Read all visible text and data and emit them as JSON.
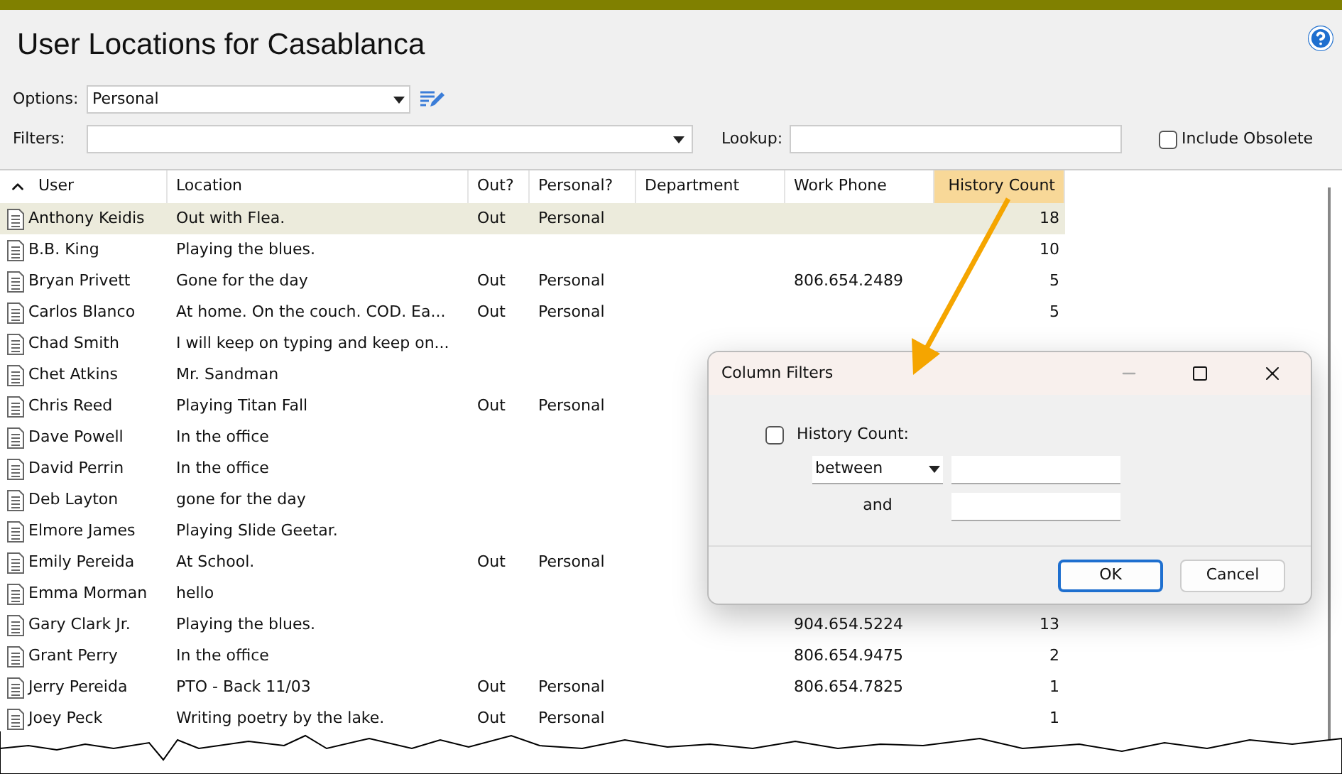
{
  "window": {
    "title": "User Locations for Casablanca"
  },
  "options": {
    "label": "Options:",
    "value": "Personal"
  },
  "filters": {
    "label": "Filters:"
  },
  "lookup": {
    "label": "Lookup:"
  },
  "include_obsolete": {
    "label": "Include Obsolete",
    "checked": false
  },
  "table": {
    "columns": [
      {
        "label": "User",
        "sorted": true,
        "highlighted": false
      },
      {
        "label": "Location",
        "sorted": false,
        "highlighted": false
      },
      {
        "label": "Out?",
        "sorted": false,
        "highlighted": false
      },
      {
        "label": "Personal?",
        "sorted": false,
        "highlighted": false
      },
      {
        "label": "Department",
        "sorted": false,
        "highlighted": false
      },
      {
        "label": "Work Phone",
        "sorted": false,
        "highlighted": false
      },
      {
        "label": "History Count",
        "sorted": false,
        "highlighted": true
      }
    ],
    "rows": [
      {
        "user": "Anthony Keidis",
        "location": "Out with Flea.",
        "out": "Out",
        "personal": "Personal",
        "phone": "",
        "count": "18",
        "selected": true
      },
      {
        "user": "B.B. King",
        "location": "Playing the blues.",
        "out": "",
        "personal": "",
        "phone": "",
        "count": "10",
        "selected": false
      },
      {
        "user": "Bryan Privett",
        "location": "Gone for the day",
        "out": "Out",
        "personal": "Personal",
        "phone": "806.654.2489",
        "count": "5",
        "selected": false
      },
      {
        "user": "Carlos Blanco",
        "location": "At home. On the couch. COD. Ea...",
        "out": "Out",
        "personal": "Personal",
        "phone": "",
        "count": "5",
        "selected": false
      },
      {
        "user": "Chad Smith",
        "location": "I will keep on typing and keep on...",
        "out": "",
        "personal": "",
        "phone": "",
        "count": "",
        "selected": false
      },
      {
        "user": "Chet Atkins",
        "location": "Mr. Sandman",
        "out": "",
        "personal": "",
        "phone": "",
        "count": "",
        "selected": false
      },
      {
        "user": "Chris Reed",
        "location": "Playing Titan Fall",
        "out": "Out",
        "personal": "Personal",
        "phone": "",
        "count": "",
        "selected": false
      },
      {
        "user": "Dave Powell",
        "location": "In the office",
        "out": "",
        "personal": "",
        "phone": "",
        "count": "",
        "selected": false
      },
      {
        "user": "David Perrin",
        "location": "In the office",
        "out": "",
        "personal": "",
        "phone": "",
        "count": "",
        "selected": false
      },
      {
        "user": "Deb Layton",
        "location": "gone for the day",
        "out": "",
        "personal": "",
        "phone": "",
        "count": "",
        "selected": false
      },
      {
        "user": "Elmore James",
        "location": "Playing Slide Geetar.",
        "out": "",
        "personal": "",
        "phone": "",
        "count": "",
        "selected": false
      },
      {
        "user": "Emily Pereida",
        "location": "At School.",
        "out": "Out",
        "personal": "Personal",
        "phone": "",
        "count": "",
        "selected": false
      },
      {
        "user": "Emma Morman",
        "location": "hello",
        "out": "",
        "personal": "",
        "phone": "",
        "count": "",
        "selected": false
      },
      {
        "user": "Gary Clark Jr.",
        "location": "Playing the blues.",
        "out": "",
        "personal": "",
        "phone": "904.654.5224",
        "count": "13",
        "selected": false
      },
      {
        "user": "Grant Perry",
        "location": "In the office",
        "out": "",
        "personal": "",
        "phone": "806.654.9475",
        "count": "2",
        "selected": false
      },
      {
        "user": "Jerry Pereida",
        "location": "PTO - Back 11/03",
        "out": "Out",
        "personal": "Personal",
        "phone": "806.654.7825",
        "count": "1",
        "selected": false
      },
      {
        "user": "Joey Peck",
        "location": "Writing poetry by the lake.",
        "out": "Out",
        "personal": "Personal",
        "phone": "",
        "count": "1",
        "selected": false
      }
    ]
  },
  "dialog": {
    "title": "Column Filters",
    "filter": {
      "label": "History Count:",
      "checked": false,
      "operator": "between",
      "and_label": "and"
    },
    "buttons": [
      {
        "label": "OK",
        "default": true
      },
      {
        "label": "Cancel",
        "default": false
      }
    ]
  }
}
